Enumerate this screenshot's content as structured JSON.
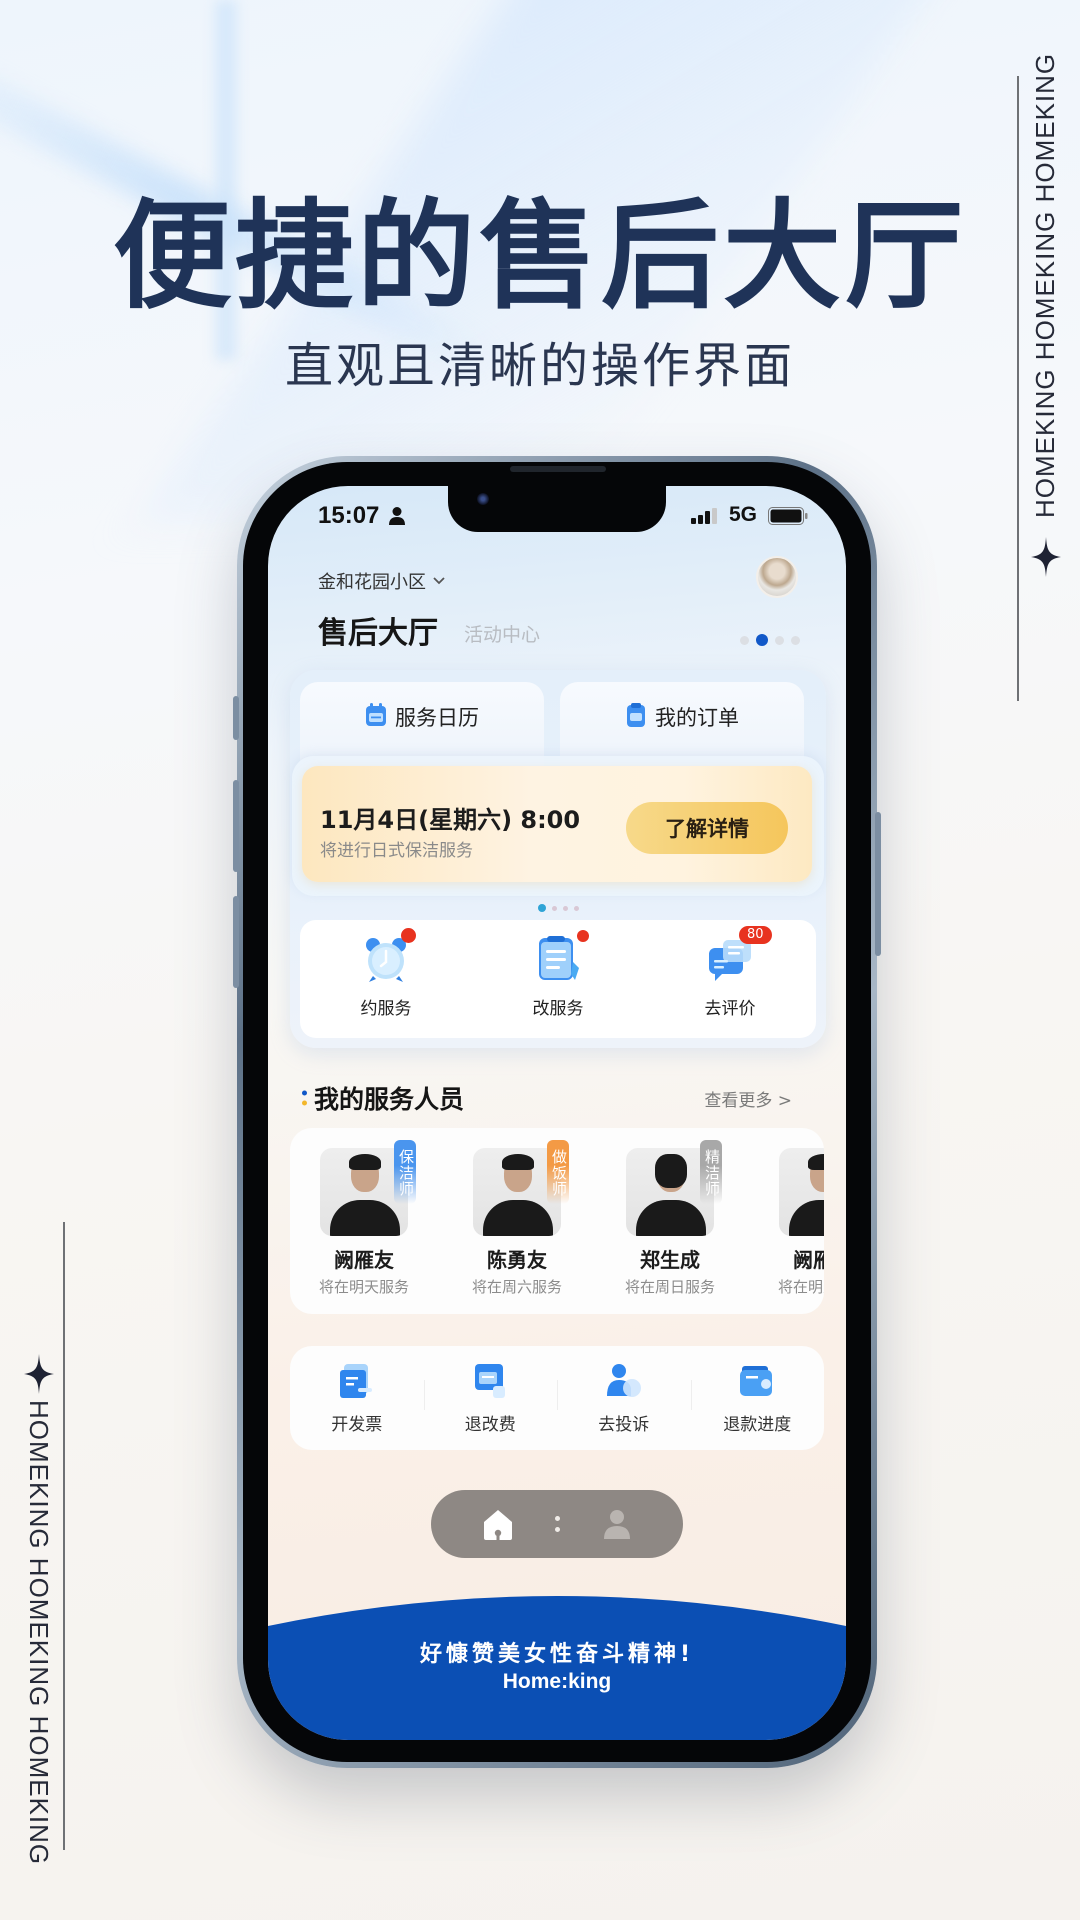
{
  "hero": {
    "title": "便捷的售后大厅",
    "subtitle": "直观且清晰的操作界面"
  },
  "brand_strip": {
    "text": "HOMEKING  HOMEKING  HOMEKING",
    "icon": "four-point-star-icon"
  },
  "colors": {
    "title": "#1f3358",
    "accent_blue": "#1158c8",
    "banner_blue": "#0b4fb4",
    "cta_yellow": "#f5c65c",
    "badge_red": "#e8331f"
  },
  "status_bar": {
    "time": "15:07",
    "network": "5G"
  },
  "header": {
    "community": "金和花园小区",
    "title": "售后大厅",
    "secondary_tab": "活动中心",
    "page_dots_count": 4,
    "page_dots_active": 2
  },
  "quick_tabs": [
    {
      "label": "服务日历",
      "icon": "calendar-icon"
    },
    {
      "label": "我的订单",
      "icon": "order-clipboard-icon"
    }
  ],
  "appointment": {
    "date": "11月4日(星期六) 8:00",
    "desc": "将进行日式保洁服务",
    "button": "了解详情",
    "carousel_count": 4,
    "carousel_active": 1
  },
  "main_actions": [
    {
      "label": "约服务",
      "icon": "alarm-clock-icon",
      "badge": "dot"
    },
    {
      "label": "改服务",
      "icon": "edit-document-icon",
      "badge": "dot"
    },
    {
      "label": "去评价",
      "icon": "comment-icon",
      "badge": "80"
    }
  ],
  "staff_section": {
    "title": "我的服务人员",
    "more": "查看更多 >",
    "items": [
      {
        "name": "阙雁友",
        "when": "将在明天服务",
        "tag": "保洁师",
        "tag_color": "#4a95ee"
      },
      {
        "name": "陈勇友",
        "when": "将在周六服务",
        "tag": "做饭师",
        "tag_color": "#f39a45"
      },
      {
        "name": "郑生成",
        "when": "将在周日服务",
        "tag": "精洁师",
        "tag_color": "#a8a8a8"
      },
      {
        "name": "阙雁友",
        "when": "将在明天服务",
        "tag": "",
        "tag_color": ""
      }
    ]
  },
  "tools": [
    {
      "label": "开发票",
      "icon": "invoice-icon"
    },
    {
      "label": "退改费",
      "icon": "refund-fee-icon"
    },
    {
      "label": "去投诉",
      "icon": "complaint-user-icon"
    },
    {
      "label": "退款进度",
      "icon": "wallet-progress-icon"
    }
  ],
  "tabbar": {
    "items": [
      {
        "name": "home",
        "icon": "home-icon",
        "active": true
      },
      {
        "name": "profile",
        "icon": "user-icon",
        "active": false
      }
    ]
  },
  "banner": {
    "slogan": "好慷赞美女性奋斗精神!",
    "brand": "Home:king"
  }
}
